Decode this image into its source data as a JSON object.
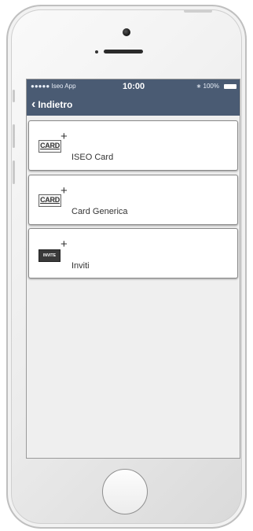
{
  "status_bar": {
    "carrier": "●●●●● Iseo App",
    "time": "10:00",
    "battery_text": "∗ 100%"
  },
  "nav": {
    "back_label": "Indietro"
  },
  "items": [
    {
      "icon_text": "CARD",
      "label": "ISEO Card"
    },
    {
      "icon_text": "CARD",
      "label": "Card Generica"
    },
    {
      "icon_text": "INVITE",
      "label": "Inviti"
    }
  ],
  "colors": {
    "nav_background": "#4a5b73",
    "screen_background": "#efefef",
    "item_background": "#ffffff"
  }
}
